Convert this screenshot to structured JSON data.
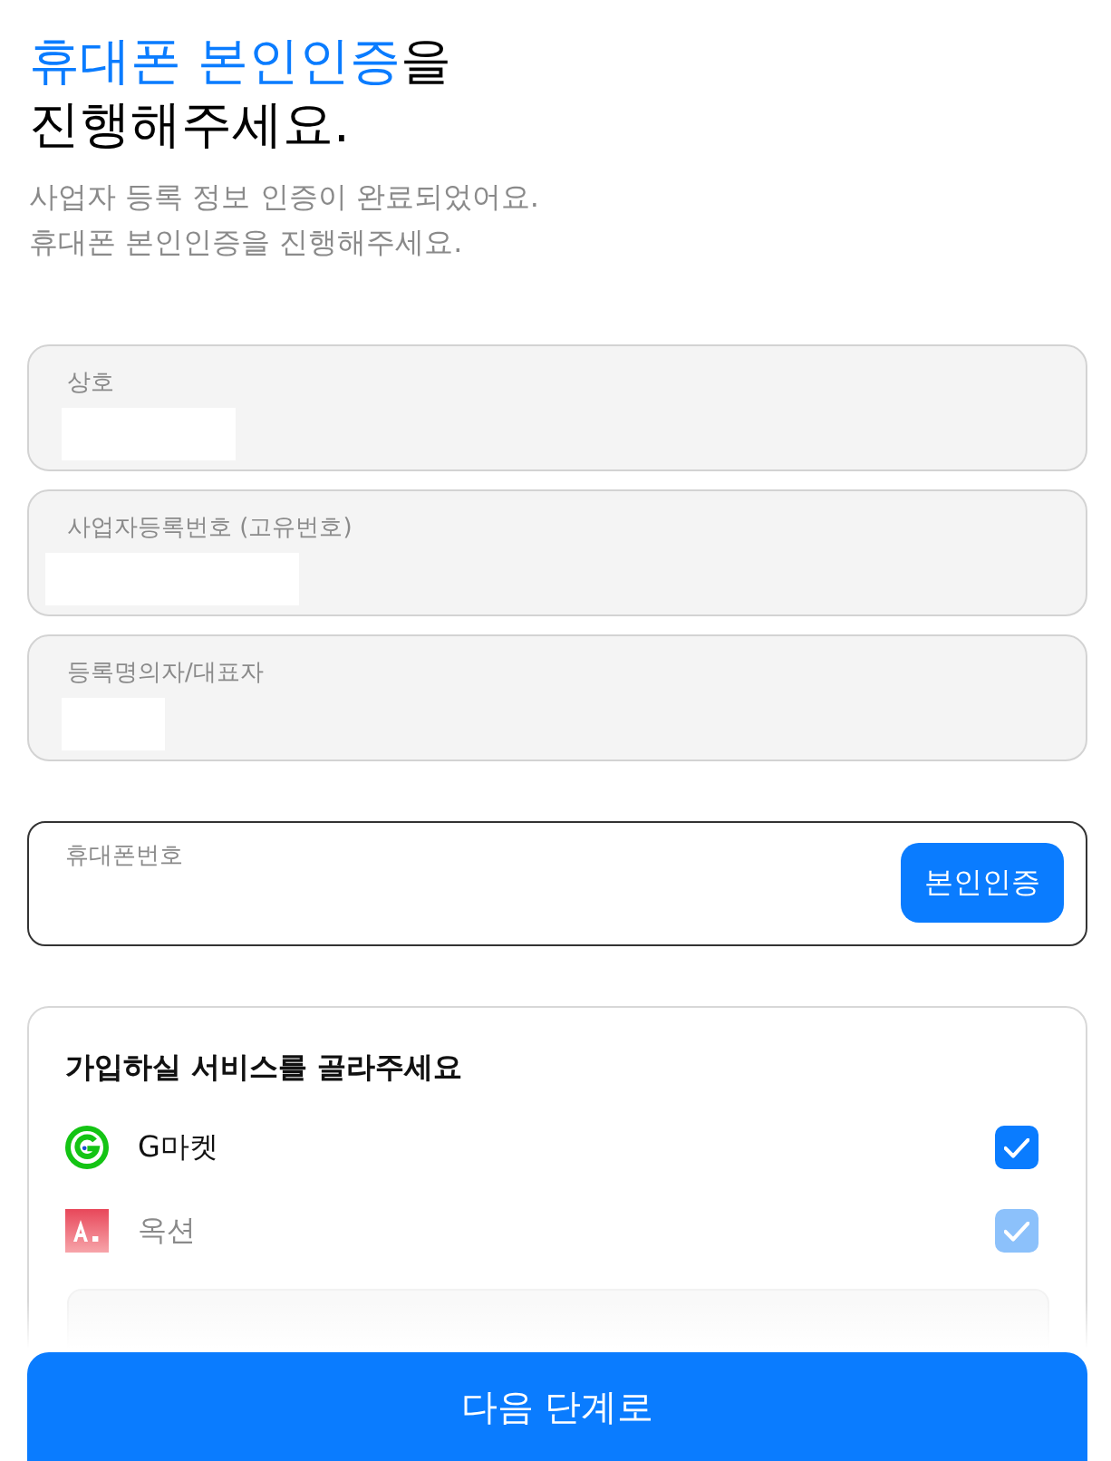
{
  "heading": {
    "title_highlight": "휴대폰 본인인증",
    "title_suffix": "을",
    "title_line2": "진행해주세요.",
    "description": [
      "사업자 등록 정보 인증이 완료되었어요.",
      "휴대폰 본인인증을 진행해주세요."
    ]
  },
  "business_fields": [
    {
      "label": "상호",
      "masked": true
    },
    {
      "label": "사업자등록번호 (고유번호)",
      "masked": true
    },
    {
      "label": "등록명의자/대표자",
      "masked": true
    }
  ],
  "phone_field": {
    "label": "휴대폰번호",
    "button": "본인인증"
  },
  "services": {
    "title": "가입하실 서비스를 골라주세요",
    "items": [
      {
        "name": "G마켓",
        "kind": "ring",
        "checked": true,
        "disabled": false
      },
      {
        "name": "옥션",
        "kind": "tile",
        "checked": true,
        "disabled": true
      }
    ]
  },
  "next_button": "다음 단계로"
}
